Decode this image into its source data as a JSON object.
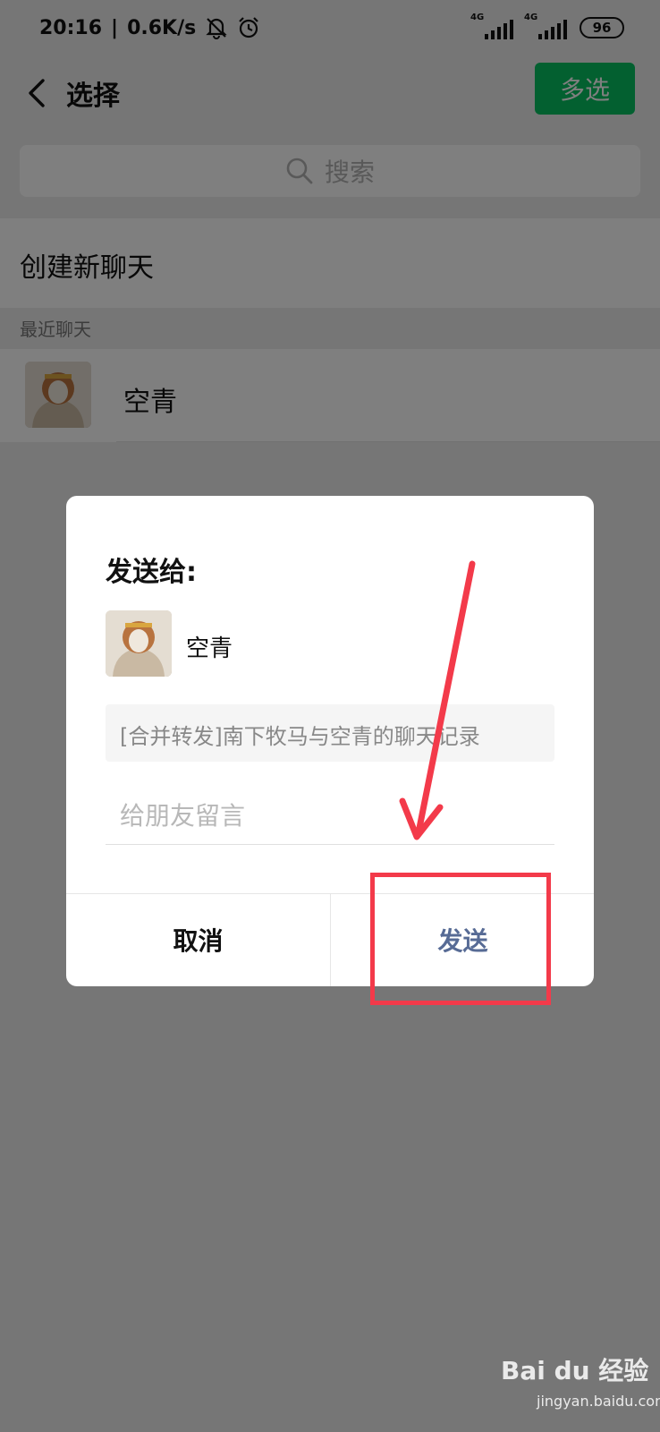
{
  "status_bar": {
    "time": "20:16",
    "separator": "|",
    "speed": "0.6K/s",
    "sim1_label": "4G",
    "sim2_label": "4G",
    "battery": "96"
  },
  "nav": {
    "title": "选择",
    "multi_select_label": "多选"
  },
  "search": {
    "placeholder": "搜索"
  },
  "new_chat_label": "创建新聊天",
  "recent_header": "最近聊天",
  "recent_contacts": [
    {
      "name": "空青"
    }
  ],
  "dialog": {
    "title": "发送给:",
    "recipient_name": "空青",
    "message_preview": "[合并转发]南下牧马与空青的聊天记录",
    "input_placeholder": "给朋友留言",
    "cancel_label": "取消",
    "send_label": "发送"
  },
  "colors": {
    "accent_green": "#07c160",
    "link_blue": "#576b95",
    "annotation_red": "#f33a4a"
  },
  "watermark": {
    "logo": "Bai du 经验",
    "url": "jingyan.baidu.com"
  }
}
